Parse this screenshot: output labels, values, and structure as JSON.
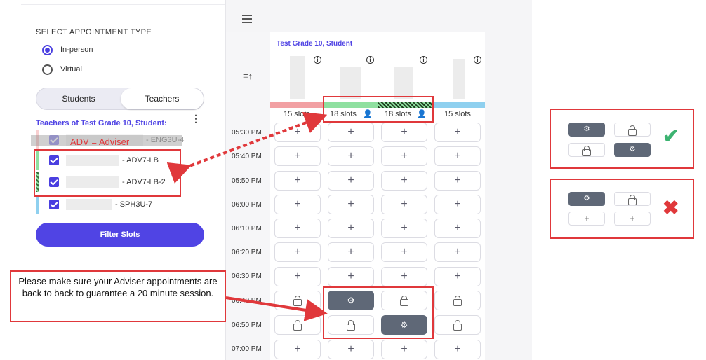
{
  "sidebar": {
    "appointment_type_label": "SELECT APPOINTMENT TYPE",
    "options": [
      {
        "label": "In-person",
        "selected": true
      },
      {
        "label": "Virtual",
        "selected": false
      }
    ],
    "toggle": {
      "students": "Students",
      "teachers": "Teachers",
      "active": "teachers"
    },
    "teachers_heading": "Teachers of Test Grade 10, Student:",
    "more_icon": "kebab-menu-icon",
    "teachers": [
      {
        "course": "- ENG3U-4",
        "color": "#f2a0a3"
      },
      {
        "course": "- ADV7-LB",
        "color": "#8fe0a0"
      },
      {
        "course": "- ADV7-LB-2",
        "color": "#3a6b3a"
      },
      {
        "course": "- SPH3U-7",
        "color": "#8fd0ef"
      }
    ],
    "filter_button": "Filter Slots"
  },
  "annotation": {
    "adv_note": "ADV = Adviser",
    "callout": "Please make sure your Adviser appointments are back to back to guarantee a 20 minute session."
  },
  "schedule": {
    "student_title": "Test Grade 10, Student",
    "columns": [
      {
        "slots": "15 slots",
        "color": "#f2a0a3"
      },
      {
        "slots": "18 slots",
        "color": "#8fe0a0"
      },
      {
        "slots": "18 slots",
        "color": "#3a6b3a"
      },
      {
        "slots": "15 slots",
        "color": "#8fd0ef"
      }
    ],
    "times": [
      "05:30 PM",
      "05:40 PM",
      "05:50 PM",
      "06:00 PM",
      "06:10 PM",
      "06:20 PM",
      "06:30 PM",
      "06:40 PM",
      "06:50 PM",
      "07:00 PM"
    ]
  },
  "colors": {
    "accent": "#5044e4",
    "highlight": "#e0383b",
    "gear_fill": "#5f6877"
  }
}
